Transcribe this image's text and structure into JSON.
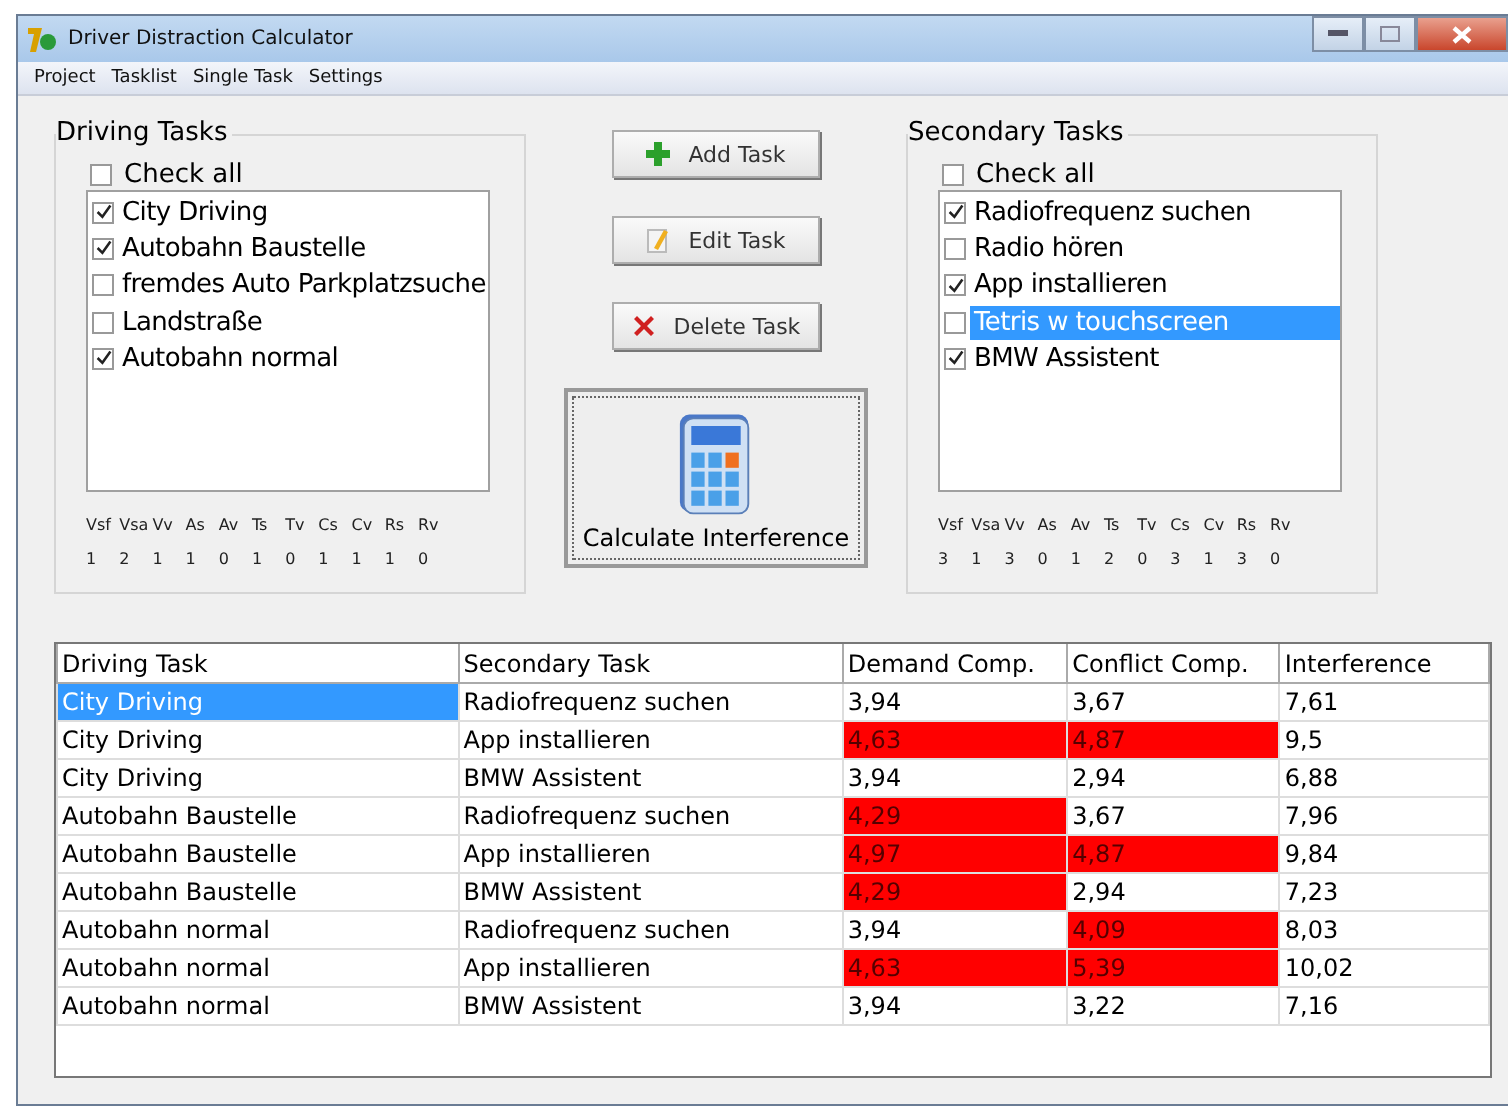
{
  "window": {
    "title": "Driver Distraction Calculator"
  },
  "menu": [
    "Project",
    "Tasklist",
    "Single Task",
    "Settings"
  ],
  "driving_tasks": {
    "title": "Driving Tasks",
    "check_all": {
      "label": "Check all",
      "checked": false
    },
    "items": [
      {
        "label": "City Driving",
        "checked": true,
        "selected": false
      },
      {
        "label": "Autobahn Baustelle",
        "checked": true,
        "selected": false
      },
      {
        "label": "fremdes Auto Parkplatzsuche",
        "checked": false,
        "selected": false
      },
      {
        "label": "Landstraße",
        "checked": false,
        "selected": false
      },
      {
        "label": "Autobahn normal",
        "checked": true,
        "selected": false
      }
    ],
    "codes": [
      "Vsf",
      "Vsa",
      "Vv",
      "As",
      "Av",
      "Ts",
      "Tv",
      "Cs",
      "Cv",
      "Rs",
      "Rv"
    ],
    "values": [
      "1",
      "2",
      "1",
      "1",
      "0",
      "1",
      "0",
      "1",
      "1",
      "1",
      "0"
    ]
  },
  "buttons": [
    {
      "kind": "add",
      "label": "Add Task"
    },
    {
      "kind": "edit",
      "label": "Edit Task"
    },
    {
      "kind": "delete",
      "label": "Delete Task"
    }
  ],
  "calculate_button": {
    "label": "Calculate Interference"
  },
  "secondary_tasks": {
    "title": "Secondary Tasks",
    "check_all": {
      "label": "Check all",
      "checked": false
    },
    "items": [
      {
        "label": "Radiofrequenz suchen",
        "checked": true,
        "selected": false
      },
      {
        "label": "Radio hören",
        "checked": false,
        "selected": false
      },
      {
        "label": "App installieren",
        "checked": true,
        "selected": false
      },
      {
        "label": "Tetris w touchscreen",
        "checked": false,
        "selected": true
      },
      {
        "label": "BMW Assistent",
        "checked": true,
        "selected": false
      }
    ],
    "codes": [
      "Vsf",
      "Vsa",
      "Vv",
      "As",
      "Av",
      "Ts",
      "Tv",
      "Cs",
      "Cv",
      "Rs",
      "Rv"
    ],
    "values": [
      "3",
      "1",
      "3",
      "0",
      "1",
      "2",
      "0",
      "3",
      "1",
      "3",
      "0"
    ]
  },
  "table": {
    "columns": [
      "Driving Task",
      "Secondary Task",
      "Demand Comp.",
      "Conflict Comp.",
      "Interference"
    ],
    "rows": [
      {
        "selected": true,
        "cells": [
          {
            "text": "City Driving",
            "high": false
          },
          {
            "text": "Radiofrequenz suchen",
            "high": false
          },
          {
            "text": "3,94",
            "high": false
          },
          {
            "text": "3,67",
            "high": false
          },
          {
            "text": "7,61",
            "high": false
          }
        ]
      },
      {
        "selected": false,
        "cells": [
          {
            "text": "City Driving",
            "high": false
          },
          {
            "text": "App installieren",
            "high": false
          },
          {
            "text": "4,63",
            "high": true
          },
          {
            "text": "4,87",
            "high": true
          },
          {
            "text": "9,5",
            "high": false
          }
        ]
      },
      {
        "selected": false,
        "cells": [
          {
            "text": "City Driving",
            "high": false
          },
          {
            "text": "BMW Assistent",
            "high": false
          },
          {
            "text": "3,94",
            "high": false
          },
          {
            "text": "2,94",
            "high": false
          },
          {
            "text": "6,88",
            "high": false
          }
        ]
      },
      {
        "selected": false,
        "cells": [
          {
            "text": "Autobahn Baustelle",
            "high": false
          },
          {
            "text": "Radiofrequenz suchen",
            "high": false
          },
          {
            "text": "4,29",
            "high": true
          },
          {
            "text": "3,67",
            "high": false
          },
          {
            "text": "7,96",
            "high": false
          }
        ]
      },
      {
        "selected": false,
        "cells": [
          {
            "text": "Autobahn Baustelle",
            "high": false
          },
          {
            "text": "App installieren",
            "high": false
          },
          {
            "text": "4,97",
            "high": true
          },
          {
            "text": "4,87",
            "high": true
          },
          {
            "text": "9,84",
            "high": false
          }
        ]
      },
      {
        "selected": false,
        "cells": [
          {
            "text": "Autobahn Baustelle",
            "high": false
          },
          {
            "text": "BMW Assistent",
            "high": false
          },
          {
            "text": "4,29",
            "high": true
          },
          {
            "text": "2,94",
            "high": false
          },
          {
            "text": "7,23",
            "high": false
          }
        ]
      },
      {
        "selected": false,
        "cells": [
          {
            "text": "Autobahn normal",
            "high": false
          },
          {
            "text": "Radiofrequenz suchen",
            "high": false
          },
          {
            "text": "3,94",
            "high": false
          },
          {
            "text": "4,09",
            "high": true
          },
          {
            "text": "8,03",
            "high": false
          }
        ]
      },
      {
        "selected": false,
        "cells": [
          {
            "text": "Autobahn normal",
            "high": false
          },
          {
            "text": "App installieren",
            "high": false
          },
          {
            "text": "4,63",
            "high": true
          },
          {
            "text": "5,39",
            "high": true
          },
          {
            "text": "10,02",
            "high": false
          }
        ]
      },
      {
        "selected": false,
        "cells": [
          {
            "text": "Autobahn normal",
            "high": false
          },
          {
            "text": "BMW Assistent",
            "high": false
          },
          {
            "text": "3,94",
            "high": false
          },
          {
            "text": "3,22",
            "high": false
          },
          {
            "text": "7,16",
            "high": false
          }
        ]
      }
    ]
  }
}
